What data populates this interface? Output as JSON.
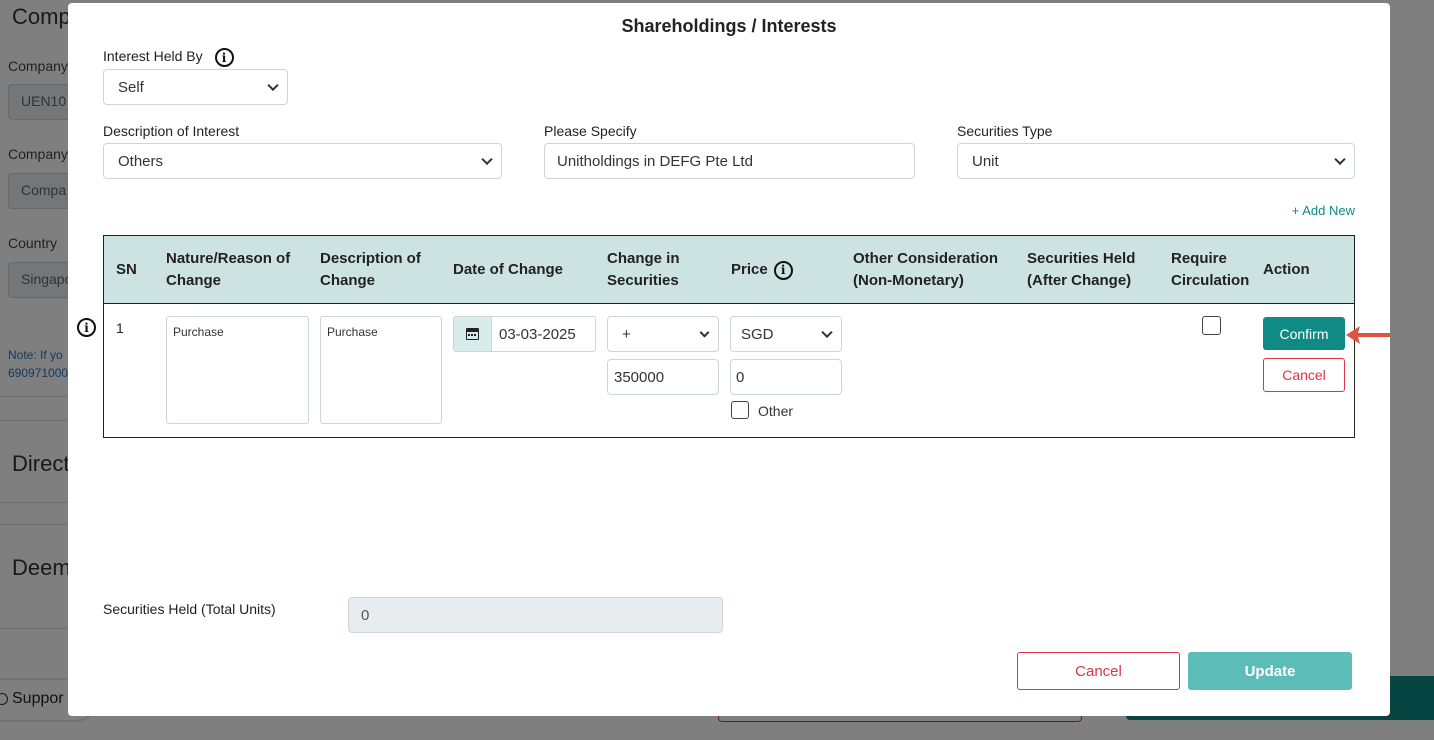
{
  "background": {
    "heading_company": "Comp",
    "company_label_1": "Company",
    "company_value_1": "UEN10",
    "company_label_2": "Company",
    "company_value_2": "Compa",
    "country_label": "Country",
    "country_value": "Singapo",
    "note_line1": "Note: If yo",
    "note_line2": "690971000",
    "heading_direct": "Direct",
    "heading_deemed": "Deem",
    "support_label": "Suppor"
  },
  "modal": {
    "title": "Shareholdings / Interests",
    "interest_held_by": {
      "label": "Interest Held By",
      "value": "Self"
    },
    "description_of_interest": {
      "label": "Description of Interest",
      "value": "Others"
    },
    "please_specify": {
      "label": "Please Specify",
      "value": "Unitholdings in DEFG Pte Ltd"
    },
    "securities_type": {
      "label": "Securities Type",
      "value": "Unit"
    },
    "add_new": "+ Add New",
    "table": {
      "headers": {
        "sn": "SN",
        "nature_line1": "Nature/Reason of",
        "nature_line2": "Change",
        "description_line1": "Description of",
        "description_line2": "Change",
        "date": "Date of Change",
        "change_line1": "Change in",
        "change_line2": "Securities",
        "price": "Price",
        "other_line1": "Other Consideration",
        "other_line2": "(Non-Monetary)",
        "held_line1": "Securities Held",
        "held_line2": "(After Change)",
        "require_line1": "Require",
        "require_line2": "Circulation",
        "action": "Action"
      },
      "row": {
        "sn": "1",
        "nature": "Purchase",
        "description": "Purchase",
        "date": "03-03-2025",
        "change_sign": "+",
        "change_amount": "350000",
        "currency": "SGD",
        "price_value": "0",
        "other_label": "Other",
        "require_circulation": false,
        "confirm_label": "Confirm",
        "cancel_label": "Cancel"
      }
    },
    "total": {
      "label": "Securities Held (Total Units)",
      "value": "0"
    },
    "footer": {
      "cancel_label": "Cancel",
      "update_label": "Update"
    },
    "info_glyph": "i"
  },
  "colors": {
    "teal": "#0f8a85",
    "teal_light": "#5cbcb8",
    "header_bg": "#cde3e2",
    "danger": "#dc3545",
    "arrow": "#e2533c"
  }
}
